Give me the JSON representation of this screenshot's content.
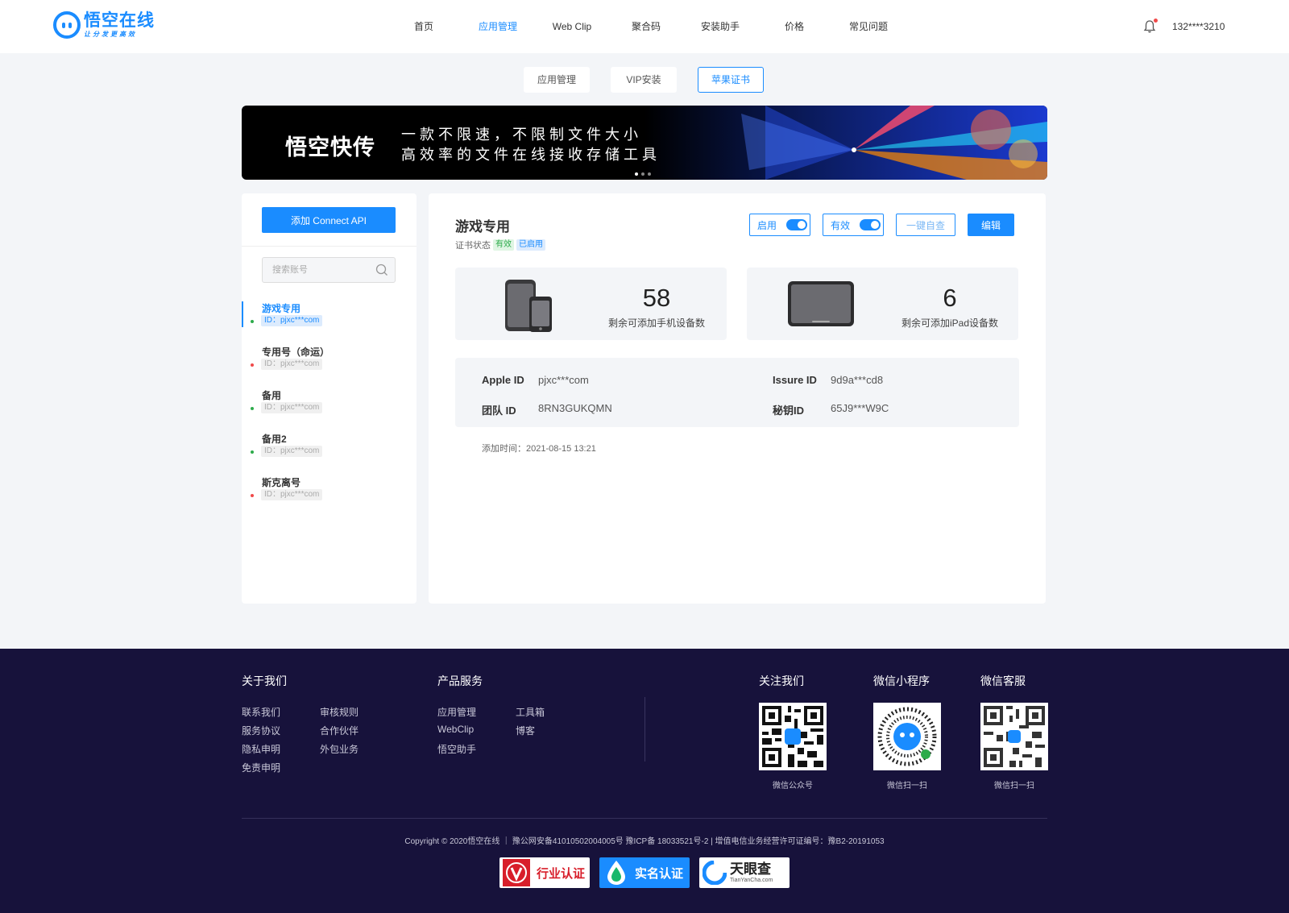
{
  "header": {
    "logo_title": "悟空在线",
    "logo_sub": "让分发更高效",
    "nav": [
      "首页",
      "应用管理",
      "Web Clip",
      "聚合码",
      "安装助手",
      "价格",
      "常见问题"
    ],
    "nav_active": "应用管理",
    "user_phone": "132****3210",
    "notification_icon": "bell-icon"
  },
  "subtabs": [
    "应用管理",
    "VIP安装",
    "苹果证书"
  ],
  "subtab_active": "苹果证书",
  "banner": {
    "title": "悟空快传",
    "line1": "一款不限速，不限制文件大小",
    "line2": "高效率的文件在线接收存储工具",
    "slide_count": 3,
    "active_slide": 1
  },
  "sidebar": {
    "add_button": "添加 Connect API",
    "search_placeholder": "搜索账号",
    "accounts": [
      {
        "name": "游戏专用",
        "id": "ID：pjxc***com",
        "status_color": "#2dab4b",
        "active": true
      },
      {
        "name": "专用号（命运）",
        "id": "ID：pjxc***com",
        "status_color": "#f04a4a",
        "active": false
      },
      {
        "name": "备用",
        "id": "ID：pjxc***com",
        "status_color": "#2dab4b",
        "active": false
      },
      {
        "name": "备用2",
        "id": "ID：pjxc***com",
        "status_color": "#2dab4b",
        "active": false
      },
      {
        "name": "斯克离号",
        "id": "ID：pjxc***com",
        "status_color": "#f04a4a",
        "active": false
      }
    ]
  },
  "detail": {
    "title": "游戏专用",
    "status_label": "证书状态",
    "status_tags": [
      "有效",
      "已启用"
    ],
    "actions": {
      "enable_label": "启用",
      "valid_label": "有效",
      "self_check": "一键自查",
      "edit": "编辑"
    },
    "stats": [
      {
        "value": "58",
        "label": "剩余可添加手机设备数",
        "icon": "phone-icon"
      },
      {
        "value": "6",
        "label": "剩余可添加iPad设备数",
        "icon": "ipad-icon"
      }
    ],
    "info": {
      "apple_id_label": "Apple ID",
      "apple_id": "pjxc***com",
      "issure_id_label": "Issure ID",
      "issure_id": "9d9a***cd8",
      "team_id_label": "团队 ID",
      "team_id": "8RN3GUKQMN",
      "secret_label": "秘钥ID",
      "secret_id": "65J9***W9C"
    },
    "added_time": "添加时间：2021-08-15 13:21"
  },
  "footer": {
    "about": {
      "heading": "关于我们",
      "links": [
        "联系我们",
        "审核规则",
        "服务协议",
        "合作伙伴",
        "隐私申明",
        "外包业务",
        "免责申明"
      ]
    },
    "products": {
      "heading": "产品服务",
      "links": [
        "应用管理",
        "工具箱",
        "WebClip",
        "博客",
        "悟空助手"
      ]
    },
    "follow": [
      {
        "heading": "关注我们",
        "caption": "微信公众号"
      },
      {
        "heading": "微信小程序",
        "caption": "微信扫一扫"
      },
      {
        "heading": "微信客服",
        "caption": "微信扫一扫"
      }
    ],
    "copyright": "Copyright © 2020悟空在线 ｜ 豫公网安备41010502004005号  豫ICP备 18033521号-2 | 增值电信业务经营许可证编号：豫B2-20191053",
    "badges": [
      "行业认证",
      "实名认证",
      "天眼查"
    ],
    "badge_subtext": "TianYanCha.com",
    "colors": {
      "background": "#17123b",
      "accent": "#1a8cff"
    }
  }
}
